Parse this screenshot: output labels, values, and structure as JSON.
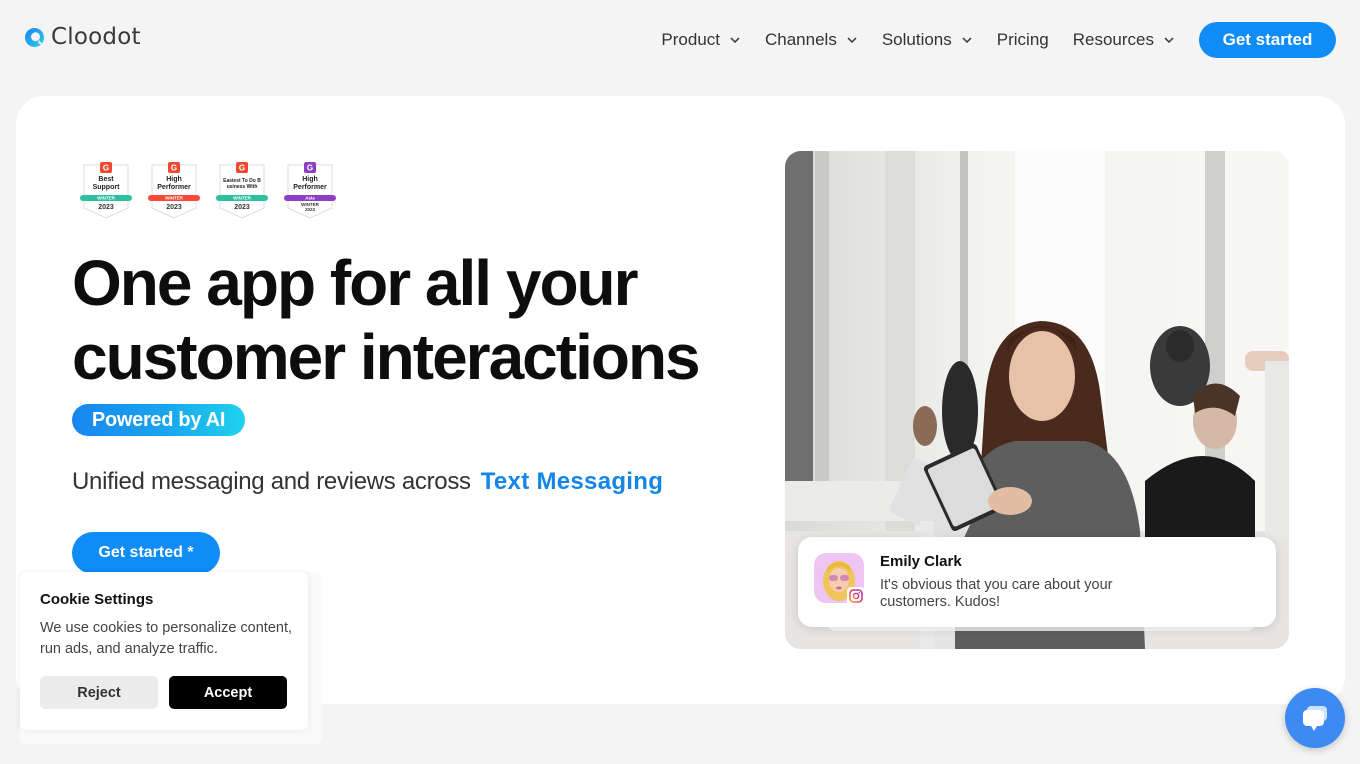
{
  "brand": {
    "name": "Cloodot",
    "accent_color": "#0f8cf5"
  },
  "nav": {
    "items": [
      {
        "label": "Product",
        "has_dropdown": true
      },
      {
        "label": "Channels",
        "has_dropdown": true
      },
      {
        "label": "Solutions",
        "has_dropdown": true
      },
      {
        "label": "Pricing",
        "has_dropdown": false
      },
      {
        "label": "Resources",
        "has_dropdown": true
      }
    ],
    "cta_label": "Get started"
  },
  "hero": {
    "badges": [
      {
        "brand": "G",
        "title": "Best Support",
        "season": "WINTER",
        "year": "2023",
        "color": "#2ebfa0"
      },
      {
        "brand": "G",
        "title": "High Performer",
        "season": "WINTER",
        "year": "2023",
        "color": "#f34a3a"
      },
      {
        "brand": "G",
        "title": "Easiest To Do Business With",
        "season": "WINTER",
        "year": "2023",
        "color": "#2ebfa0"
      },
      {
        "brand": "G",
        "title": "High Performer",
        "region": "Asia",
        "season": "WINTER",
        "year": "2023",
        "color": "#8e3fc2"
      }
    ],
    "headline_line1": "One app for all your",
    "headline_line2": "customer interactions",
    "ai_pill": "Powered by AI",
    "subline_prefix": "Unified messaging and reviews across",
    "subline_accent": "Text Messaging",
    "cta_label": "Get started *"
  },
  "review": {
    "name": "Emily Clark",
    "text": "It's obvious that you care about your customers. Kudos!",
    "source_icon": "instagram-icon"
  },
  "cookie": {
    "title": "Cookie Settings",
    "text": "We use cookies to personalize content, run ads, and analyze traffic.",
    "reject_label": "Reject",
    "accept_label": "Accept"
  },
  "chat": {
    "icon": "chat-bubbles-icon"
  }
}
